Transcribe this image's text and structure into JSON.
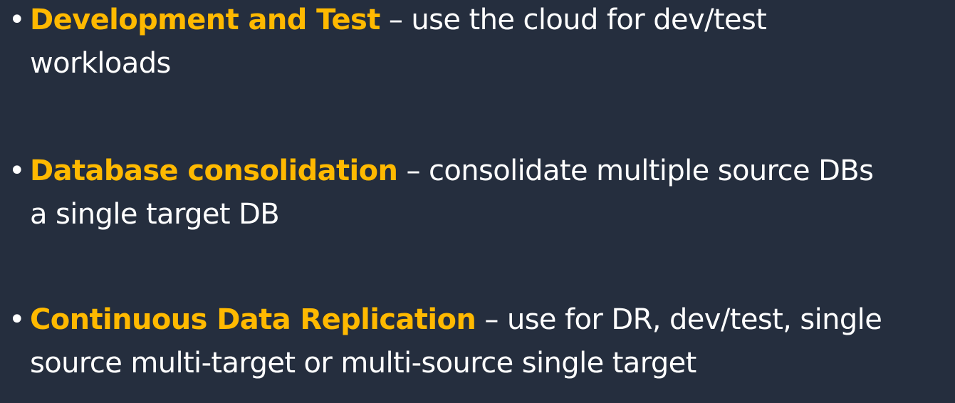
{
  "colors": {
    "background": "#252e3e",
    "term": "#ffb900",
    "text": "#ffffff"
  },
  "bullets": [
    {
      "marker": "•",
      "term": "Development and Test",
      "desc_line1": " – use the cloud for dev/test",
      "desc_line2": "workloads"
    },
    {
      "marker": "•",
      "term": "Database consolidation",
      "desc_line1": " – consolidate multiple source DBs",
      "desc_line2": "a single target DB"
    },
    {
      "marker": "•",
      "term": "Continuous Data Replication",
      "desc_line1": " – use for DR, dev/test, single",
      "desc_line2": "source multi-target or multi-source single target"
    }
  ]
}
